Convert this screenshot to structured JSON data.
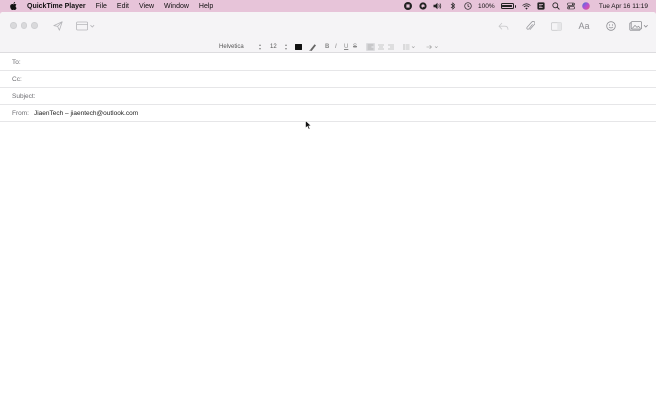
{
  "menubar": {
    "app_name": "QuickTime Player",
    "items": [
      "File",
      "Edit",
      "View",
      "Window",
      "Help"
    ],
    "battery": "100%",
    "clock": "Tue Apr 16  11:19",
    "icons": [
      "apple-icon",
      "record-icon",
      "quicktime-icon",
      "volume-icon",
      "bluetooth-icon",
      "clock-icon",
      "battery-icon",
      "wifi-icon",
      "screen-icon",
      "search-icon",
      "control-center-icon",
      "siri-icon"
    ]
  },
  "toolbar": {
    "icons": [
      "send-icon",
      "header-fields-icon",
      "reply-icon",
      "attachment-icon",
      "markup-icon",
      "font-icon",
      "emoji-icon",
      "photo-icon"
    ],
    "font_label": "Aa"
  },
  "format": {
    "font": "Helvetica",
    "size": "12",
    "text_color": "#111111"
  },
  "compose": {
    "to_label": "To:",
    "cc_label": "Cc:",
    "subject_label": "Subject:",
    "from_label": "From:",
    "from_value": "JiaenTech – jiaentech@outlook.com"
  }
}
